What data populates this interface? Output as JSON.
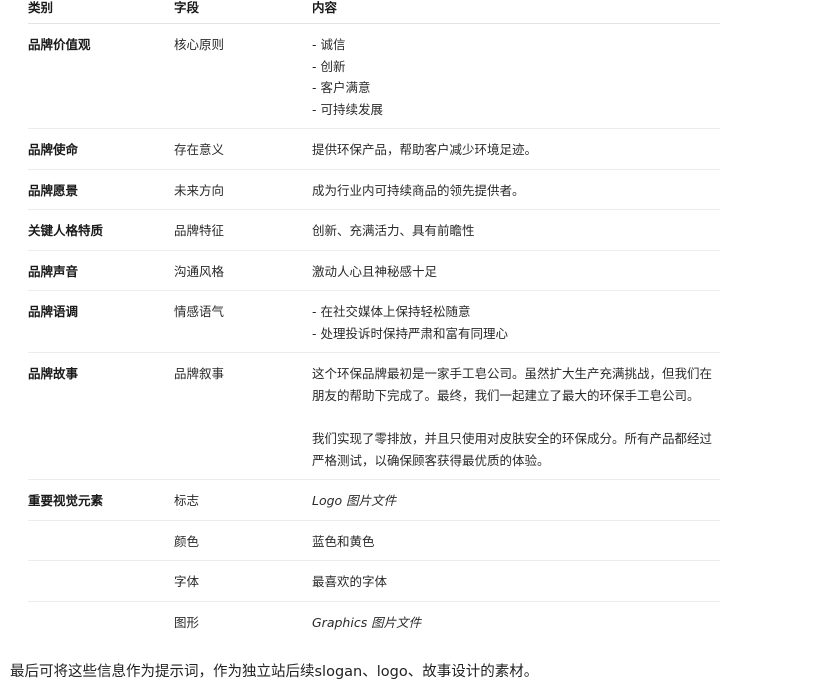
{
  "table": {
    "headers": [
      "类别",
      "字段",
      "内容"
    ],
    "rows": [
      {
        "category": "品牌价值观",
        "field": "核心原则",
        "content": [
          "- 诚信",
          "- 创新",
          "- 客户满意",
          "- 可持续发展"
        ]
      },
      {
        "category": "品牌使命",
        "field": "存在意义",
        "content": [
          "提供环保产品，帮助客户减少环境足迹。"
        ]
      },
      {
        "category": "品牌愿景",
        "field": "未来方向",
        "content": [
          "成为行业内可持续商品的领先提供者。"
        ]
      },
      {
        "category": "关键人格特质",
        "field": "品牌特征",
        "content": [
          "创新、充满活力、具有前瞻性"
        ]
      },
      {
        "category": "品牌声音",
        "field": "沟通风格",
        "content": [
          "激动人心且神秘感十足"
        ]
      },
      {
        "category": "品牌语调",
        "field": "情感语气",
        "content": [
          "- 在社交媒体上保持轻松随意",
          "- 处理投诉时保持严肃和富有同理心"
        ]
      },
      {
        "category": "品牌故事",
        "field": "品牌叙事",
        "content": [
          "这个环保品牌最初是一家手工皂公司。虽然扩大生产充满挑战，但我们在",
          "朋友的帮助下完成了。最终，我们一起建立了最大的环保手工皂公司。",
          "",
          "我们实现了零排放，并且只使用对皮肤安全的环保成分。所有产品都经过",
          "严格测试，以确保顾客获得最优质的体验。"
        ]
      },
      {
        "category": "重要视觉元素",
        "field": "标志",
        "content": [
          "Logo 图片文件"
        ]
      },
      {
        "category": "",
        "field": "颜色",
        "content": [
          "蓝色和黄色"
        ]
      },
      {
        "category": "",
        "field": "字体",
        "content": [
          "最喜欢的字体"
        ]
      },
      {
        "category": "",
        "field": "图形",
        "content": [
          "Graphics 图片文件"
        ]
      }
    ]
  },
  "footer": "最后可将这些信息作为提示词，作为独立站后续slogan、logo、故事设计的素材。"
}
